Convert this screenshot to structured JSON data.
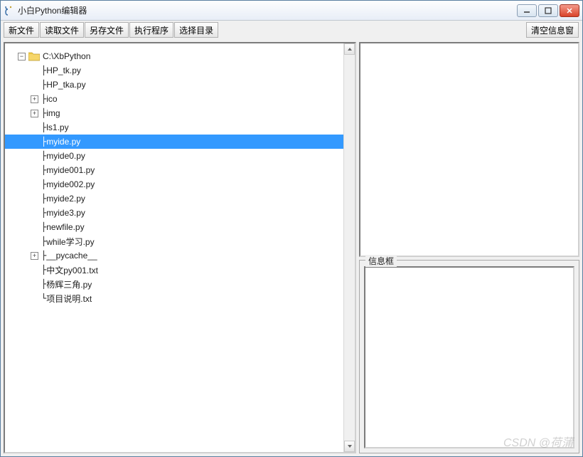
{
  "window": {
    "title": "小白Python编辑器"
  },
  "toolbar": {
    "new_file": "新文件",
    "read_file": "读取文件",
    "save_as": "另存文件",
    "run_program": "执行程序",
    "choose_dir": "选择目录",
    "clear_info": "清空信息窗"
  },
  "tree": {
    "root": {
      "label": "C:\\XbPython",
      "expanded": true
    },
    "items": [
      {
        "prefix": "├",
        "label": "HP_tk.py",
        "expandable": false
      },
      {
        "prefix": "├",
        "label": "HP_tka.py",
        "expandable": false
      },
      {
        "prefix": "├",
        "label": "ico",
        "expandable": true
      },
      {
        "prefix": "├",
        "label": "img",
        "expandable": true
      },
      {
        "prefix": "├",
        "label": "ls1.py",
        "expandable": false
      },
      {
        "prefix": "├",
        "label": "myide.py",
        "expandable": false,
        "selected": true
      },
      {
        "prefix": "├",
        "label": "myide0.py",
        "expandable": false
      },
      {
        "prefix": "├",
        "label": "myide001.py",
        "expandable": false
      },
      {
        "prefix": "├",
        "label": "myide002.py",
        "expandable": false
      },
      {
        "prefix": "├",
        "label": "myide2.py",
        "expandable": false
      },
      {
        "prefix": "├",
        "label": "myide3.py",
        "expandable": false
      },
      {
        "prefix": "├",
        "label": "newfile.py",
        "expandable": false
      },
      {
        "prefix": "├",
        "label": "while学习.py",
        "expandable": false
      },
      {
        "prefix": "├",
        "label": "__pycache__",
        "expandable": true
      },
      {
        "prefix": "├",
        "label": "中文py001.txt",
        "expandable": false
      },
      {
        "prefix": "├",
        "label": "杨辉三角.py",
        "expandable": false
      },
      {
        "prefix": "└",
        "label": "项目说明.txt",
        "expandable": false
      }
    ]
  },
  "info_box": {
    "label": "信息框"
  },
  "watermark": "CSDN @荷蒲"
}
